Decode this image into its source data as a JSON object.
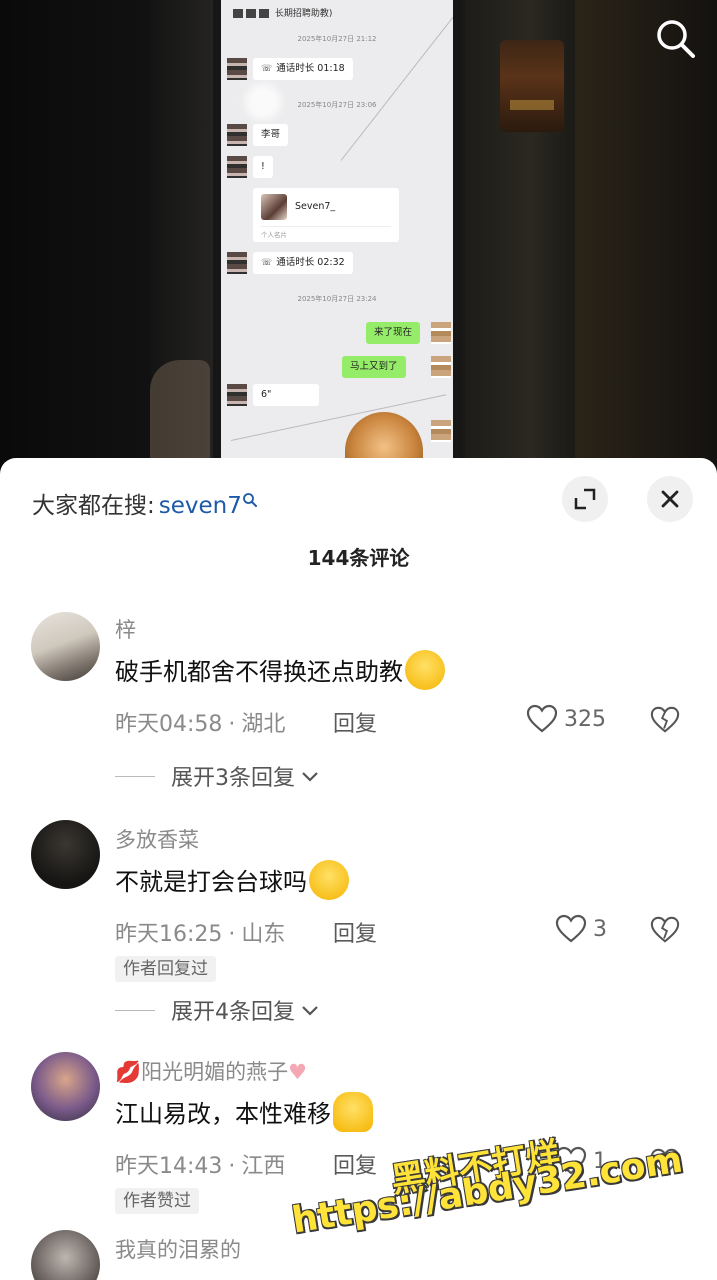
{
  "video": {
    "chat": {
      "title": "长期招聘助教)",
      "timestamps": [
        "2025年10月27日 21:12",
        "2025年10月27日 23:06",
        "2025年10月27日 23:24"
      ],
      "call1": "通话时长 01:18",
      "msg_li": "李哥",
      "msg_excl": "!",
      "card_name": "Seven7_",
      "card_footer": "个人名片",
      "call2": "通话时长 02:32",
      "msg_green1": "来了现在",
      "msg_green2": "马上又到了",
      "msg_last": "6\""
    }
  },
  "sheet": {
    "hot_search_label": "大家都在搜:",
    "hot_search_keyword": "seven7",
    "comment_count": "144条评论",
    "comments": [
      {
        "name": "梓",
        "text": "破手机都舍不得换还点助教",
        "time": "昨天04:58",
        "location": "湖北",
        "reply_label": "回复",
        "likes": "325",
        "expand": "展开3条回复"
      },
      {
        "name": "多放香菜",
        "text": "不就是打会台球吗",
        "time": "昨天16:25",
        "location": "山东",
        "reply_label": "回复",
        "likes": "3",
        "badge": "作者回复过",
        "expand": "展开4条回复"
      },
      {
        "name": "阳光明媚的燕子",
        "text": "江山易改，本性难移",
        "time": "昨天14:43",
        "location": "江西",
        "reply_label": "回复",
        "likes": "1",
        "badge": "作者赞过"
      },
      {
        "name": "我真的泪累的"
      }
    ]
  },
  "watermark": {
    "line1": "黑料不打烊",
    "line2": "https://abdy32.com"
  },
  "colors": {
    "keyword_blue": "#1d5aa8",
    "wechat_green": "#95ec69",
    "watermark_yellow": "#ffe338"
  }
}
